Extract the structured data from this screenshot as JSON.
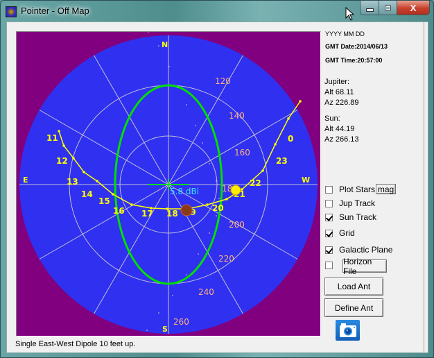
{
  "window": {
    "title": "Pointer - Off Map",
    "close_glyph": "X"
  },
  "info": {
    "date_format": "YYYY MM DD",
    "gmt_date": "GMT Date:2014/06/13",
    "gmt_time": "GMT Time:20:57:00",
    "jupiter_label": "Jupiter:",
    "jupiter_alt": "Alt 68.11",
    "jupiter_az": "Az 226.89",
    "sun_label": "Sun:",
    "sun_alt": "Alt 44.19",
    "sun_az": "Az 266.13"
  },
  "controls": {
    "plot_stars": {
      "label": "Plot Stars",
      "checked": false
    },
    "mag_button": "mag",
    "jup_track": {
      "label": "Jup Track",
      "checked": false
    },
    "sun_track": {
      "label": "Sun Track",
      "checked": true
    },
    "grid": {
      "label": "Grid",
      "checked": true
    },
    "galactic_plane": {
      "label": "Galactic Plane",
      "checked": true
    },
    "horizon_file": {
      "checked": false
    },
    "horizon_button": "Horizon File",
    "load_ant": "Load Ant",
    "define_ant": "Define Ant"
  },
  "status": "Single East-West Dipole 10 feet up.",
  "sky_map": {
    "colors": {
      "background": "#800080",
      "sky": "#3030f0",
      "grid": "#c0c0d8",
      "sun_track": "#ffff00",
      "antenna_pattern": "#00e000",
      "galactic_plane_labels": "#ffb080",
      "gain_label": "#40e0ff",
      "cardinal": "#ffff00"
    },
    "cardinals": [
      "N",
      "E",
      "S",
      "W"
    ],
    "gain_label": "5.8 dBi",
    "sun_track_hours": [
      "11",
      "12",
      "13",
      "14",
      "15",
      "16",
      "17",
      "18",
      "19",
      "20",
      "21",
      "22",
      "23",
      "0"
    ],
    "galactic_labels": [
      "120",
      "140",
      "160",
      "180",
      "200",
      "220",
      "240",
      "260"
    ]
  }
}
